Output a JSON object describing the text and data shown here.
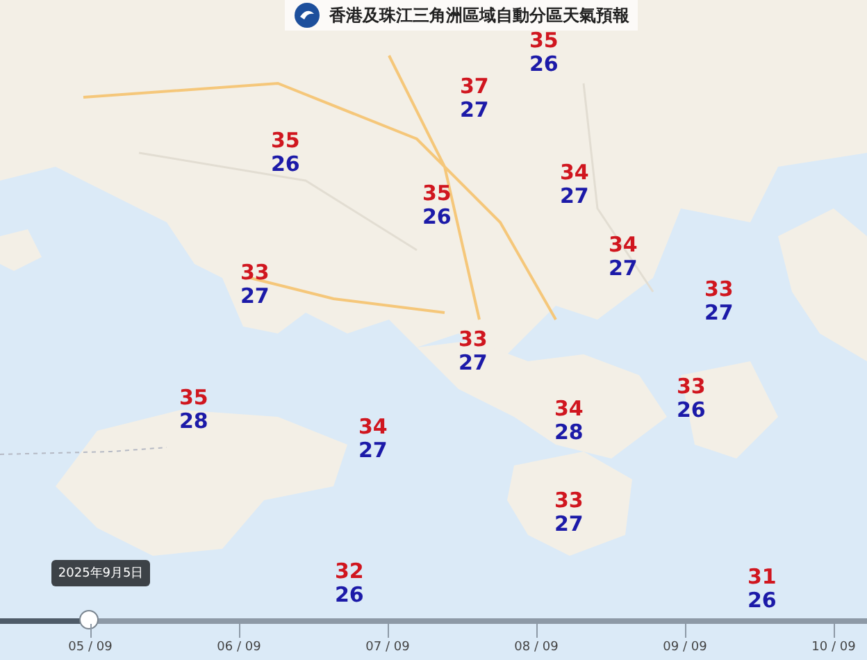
{
  "title": "香港及珠江三角洲區域自動分區天氣預報",
  "stations": [
    {
      "max": "35",
      "min": "26"
    },
    {
      "max": "37",
      "min": "27"
    },
    {
      "max": "35",
      "min": "26"
    },
    {
      "max": "35",
      "min": "26"
    },
    {
      "max": "34",
      "min": "27"
    },
    {
      "max": "33",
      "min": "27"
    },
    {
      "max": "34",
      "min": "27"
    },
    {
      "max": "33",
      "min": "27"
    },
    {
      "max": "33",
      "min": "27"
    },
    {
      "max": "35",
      "min": "28"
    },
    {
      "max": "34",
      "min": "27"
    },
    {
      "max": "34",
      "min": "28"
    },
    {
      "max": "33",
      "min": "26"
    },
    {
      "max": "33",
      "min": "27"
    },
    {
      "max": "32",
      "min": "26"
    },
    {
      "max": "31",
      "min": "26"
    }
  ],
  "timeline": {
    "level": 0.104,
    "tooltip": "2025年9月5日",
    "ticks": [
      "05 / 09",
      "06 / 09",
      "07 / 09",
      "08 / 09",
      "09 / 09",
      "10 / 09"
    ]
  }
}
